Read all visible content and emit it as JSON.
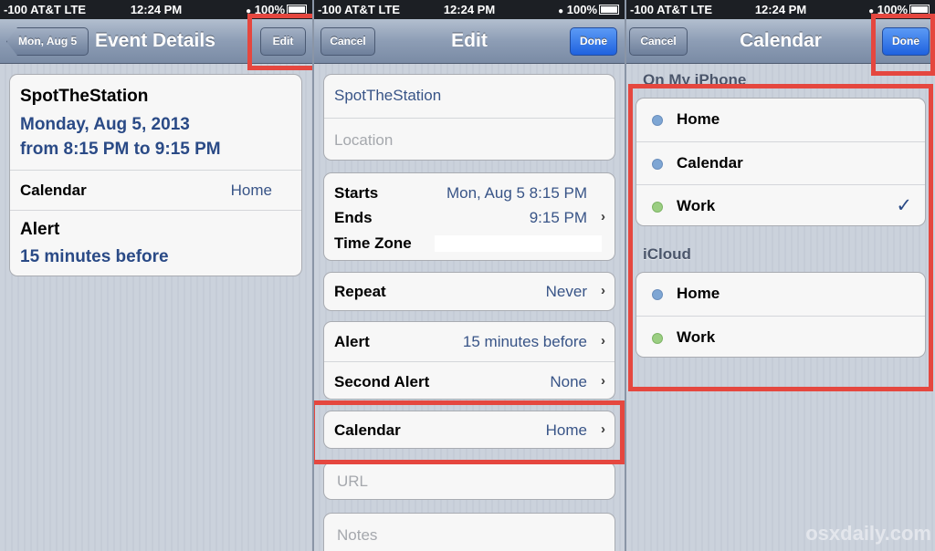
{
  "status": {
    "s1": {
      "carrier": "-100 AT&T  LTE",
      "time": "12:24 PM",
      "battery": "100%"
    },
    "s2": {
      "carrier": "-100 AT&T  LTE",
      "time": "12:24 PM",
      "battery": "100%"
    },
    "s3": {
      "carrier": "-100 AT&T  LTE",
      "time": "12:24 PM",
      "battery": "100%"
    }
  },
  "details": {
    "back_label": "Mon, Aug 5",
    "title": "Event Details",
    "edit_label": "Edit",
    "event_title": "SpotTheStation",
    "date_line": "Monday, Aug 5, 2013",
    "time_line": "from 8:15 PM to 9:15 PM",
    "calendar_label": "Calendar",
    "calendar_value": "Home",
    "alert_label": "Alert",
    "alert_value": "15 minutes before"
  },
  "edit": {
    "cancel_label": "Cancel",
    "title": "Edit",
    "done_label": "Done",
    "title_value": "SpotTheStation",
    "location_placeholder": "Location",
    "starts_label": "Starts",
    "starts_value": "Mon, Aug 5  8:15 PM",
    "ends_label": "Ends",
    "ends_value": "9:15 PM",
    "timezone_label": "Time Zone",
    "repeat_label": "Repeat",
    "repeat_value": "Never",
    "alert_label": "Alert",
    "alert_value": "15 minutes before",
    "second_alert_label": "Second Alert",
    "second_alert_value": "None",
    "calendar_label": "Calendar",
    "calendar_value": "Home",
    "url_placeholder": "URL",
    "notes_placeholder": "Notes"
  },
  "calendar": {
    "cancel_label": "Cancel",
    "title": "Calendar",
    "done_label": "Done",
    "section_iphone": "On My iPhone",
    "iphone_items": [
      {
        "label": "Home",
        "color": "#7ea6d4"
      },
      {
        "label": "Calendar",
        "color": "#7ea6d4"
      },
      {
        "label": "Work",
        "color": "#9bce82",
        "checked": true
      }
    ],
    "checkmark": "✓",
    "section_icloud": "iCloud",
    "icloud_items": [
      {
        "label": "Home",
        "color": "#7ea6d4"
      },
      {
        "label": "Work",
        "color": "#9bce82"
      }
    ]
  },
  "watermark": "osxdaily.com",
  "highlight_color": "#e5473f"
}
